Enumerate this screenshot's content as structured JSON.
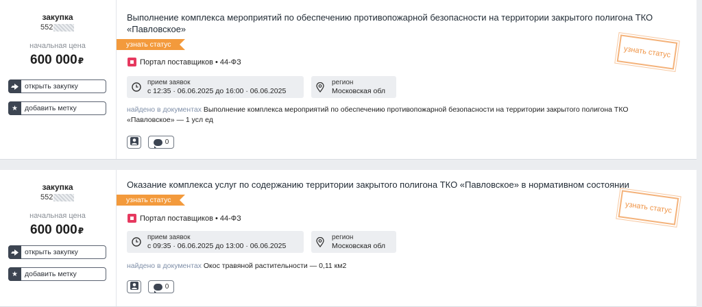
{
  "cards": [
    {
      "kind": "закупка",
      "number_prefix": "552",
      "price_label": "начальная цена",
      "price": "600 000",
      "currency": "₽",
      "open_button": "открыть закупку",
      "tag_button": "добавить метку",
      "title_line1": "Выполнение комплекса мероприятий по обеспечению противопожарной безопасности на территории закрытого полигона ТКО",
      "title_line2": "«Павловское»",
      "status_ribbon": "узнать статус",
      "stamp": "узнать статус",
      "platform": "Портал поставщиков • 44-ФЗ",
      "time_label": "прием заявок",
      "time_value": "с 12:35 · 06.06.2025 до 16:00 · 06.06.2025",
      "region_label": "регион",
      "region_value": "Московская обл",
      "found_label": "найдено в документах",
      "found_text": " Выполнение комплекса мероприятий по обеспечению противопожарной безопасности на территории закрытого полигона ТКО «Павловское» — 1 усл ед",
      "comments": "0"
    },
    {
      "kind": "закупка",
      "number_prefix": "552",
      "price_label": "начальная цена",
      "price": "600 000",
      "currency": "₽",
      "open_button": "открыть закупку",
      "tag_button": "добавить метку",
      "title_line1": "Оказание комплекса услуг по содержанию территории закрытого полигона ТКО «Павловское» в нормативном состоянии",
      "title_line2": "",
      "status_ribbon": "узнать статус",
      "stamp": "узнать статус",
      "platform": "Портал поставщиков • 44-ФЗ",
      "time_label": "прием заявок",
      "time_value": "с 09:35 · 06.06.2025 до 13:00 · 06.06.2025",
      "region_label": "регион",
      "region_value": "Московская обл",
      "found_label": "найдено в документах",
      "found_text": " Окос травяной растительности — 0,11 км2",
      "comments": "0"
    }
  ],
  "colors": {
    "accent_orange": "#f39a3c",
    "platform_logo": "#e6395f",
    "icon_dark": "#3d4552"
  }
}
